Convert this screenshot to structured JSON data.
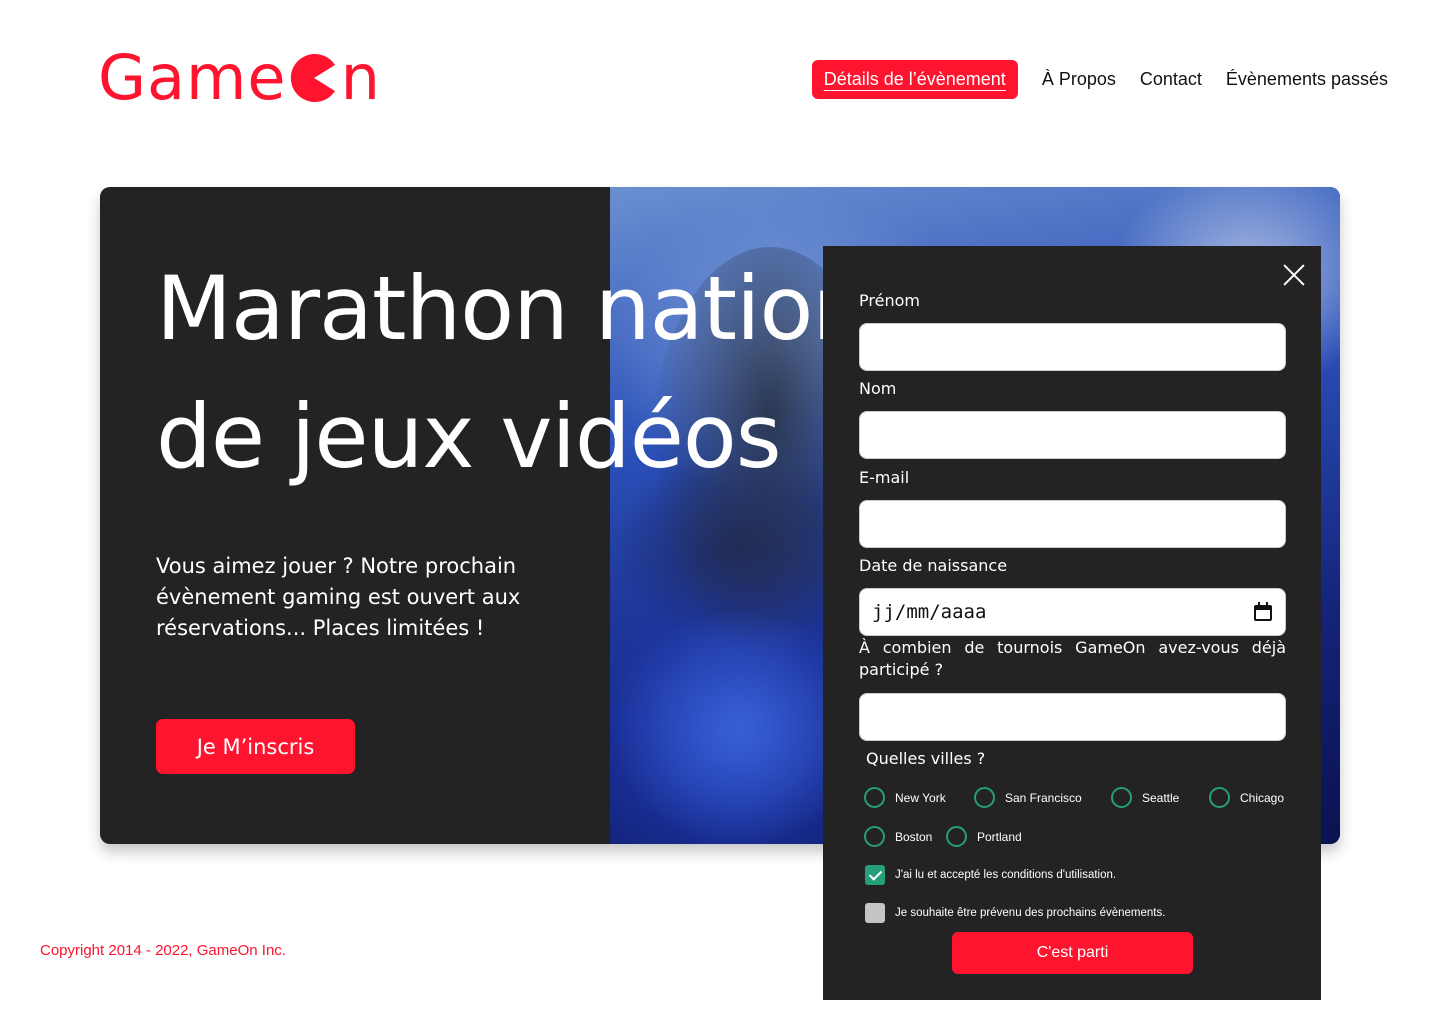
{
  "brand": {
    "name_start": "Game",
    "name_end": "n",
    "color": "#FE142F"
  },
  "nav": {
    "items": [
      {
        "label": "Détails de l’évènement",
        "active": true
      },
      {
        "label": "À Propos",
        "active": false
      },
      {
        "label": "Contact",
        "active": false
      },
      {
        "label": "Évènements passés",
        "active": false
      }
    ]
  },
  "hero": {
    "title_line1": "Marathon national",
    "title_line2": "de jeux vidéos",
    "text": "Vous aimez jouer ? Notre prochain évènement gaming est ouvert aux réservations... Places limitées !",
    "cta_label": "Je M’inscris"
  },
  "footer": {
    "copyright": "Copyright 2014 - 2022, GameOn Inc."
  },
  "modal": {
    "first_name_label": "Prénom",
    "last_name_label": "Nom",
    "email_label": "E-mail",
    "birthdate_label": "Date de naissance",
    "birthdate_placeholder": "jj/mm/aaaa",
    "tournaments_question": "À combien de tournois GameOn avez-vous déjà participé ?",
    "cities_label": "Quelles villes ?",
    "cities": [
      "New York",
      "San Francisco",
      "Seattle",
      "Chicago",
      "Boston",
      "Portland"
    ],
    "terms_label": "J'ai lu et accepté les conditions d'utilisation.",
    "terms_checked": true,
    "newsletter_label": "Je souhaite être prévenu des prochains évènements.",
    "newsletter_checked": false,
    "submit_label": "C'est parti",
    "accent_color": "#279e7a"
  }
}
